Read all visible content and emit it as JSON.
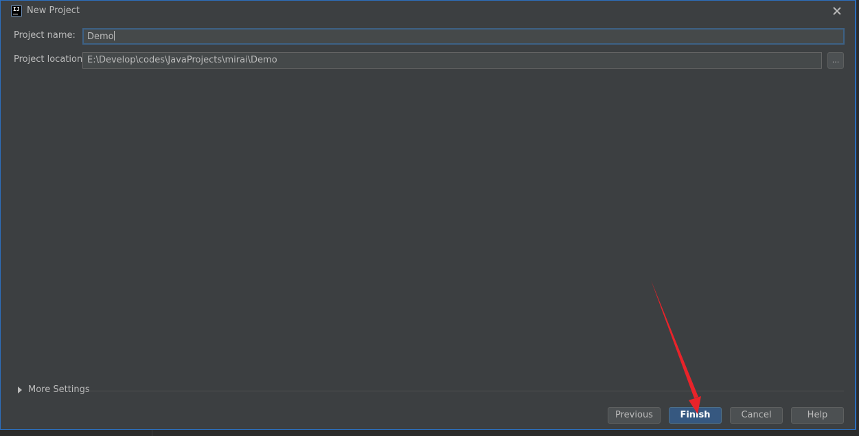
{
  "window": {
    "title": "New Project",
    "icon": "intellij-idea-icon"
  },
  "form": {
    "project_name_label": "Project name:",
    "project_name_value": "Demo",
    "project_location_label": "Project location:",
    "project_location_value": "E:\\Develop\\codes\\JavaProjects\\mirai\\Demo",
    "browse_label": "..."
  },
  "more_settings": {
    "label": "More Settings",
    "expanded": false
  },
  "buttons": {
    "previous": "Previous",
    "finish": "Finish",
    "cancel": "Cancel",
    "help": "Help"
  },
  "colors": {
    "dialog_bg": "#3c3f41",
    "input_bg": "#45494a",
    "focus_border": "#3d6185",
    "primary_button": "#365880",
    "annotation_arrow": "#e8232a"
  }
}
